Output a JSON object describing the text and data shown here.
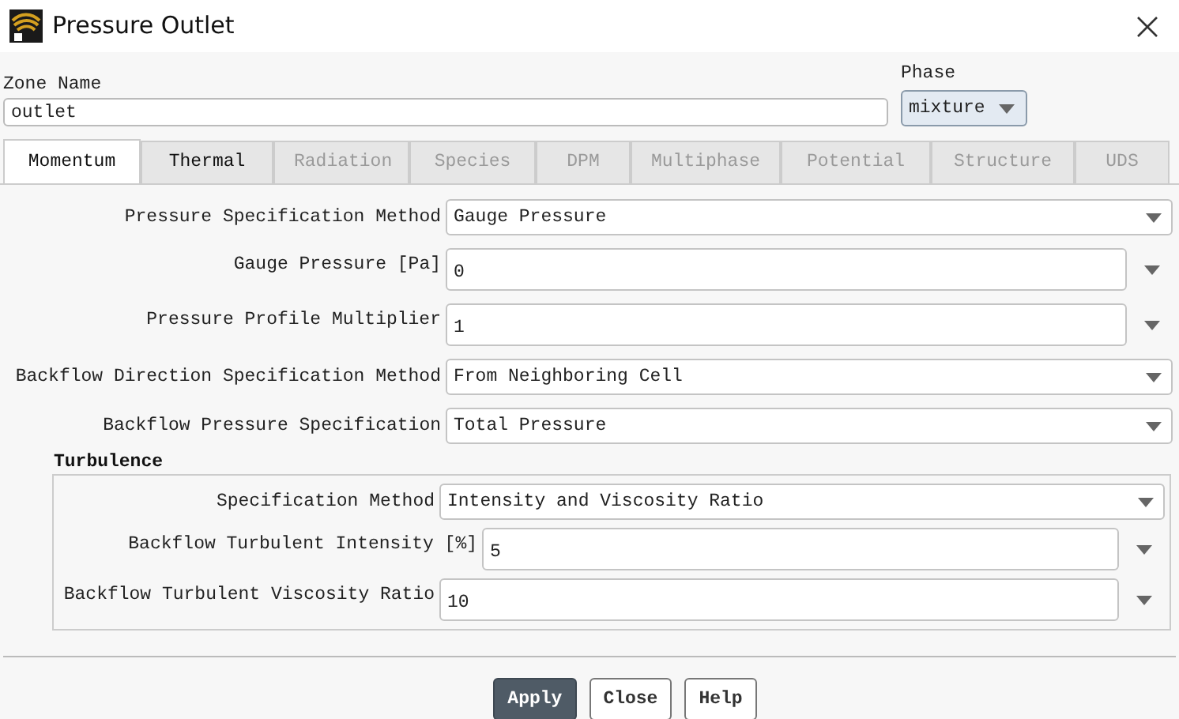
{
  "window": {
    "title": "Pressure Outlet"
  },
  "zone_name": {
    "label": "Zone Name",
    "value": "outlet"
  },
  "phase": {
    "label": "Phase",
    "value": "mixture"
  },
  "tabs": [
    {
      "label": "Momentum",
      "selected": true,
      "disabled": false
    },
    {
      "label": "Thermal",
      "selected": false,
      "disabled": false
    },
    {
      "label": "Radiation",
      "selected": false,
      "disabled": true
    },
    {
      "label": "Species",
      "selected": false,
      "disabled": true
    },
    {
      "label": "DPM",
      "selected": false,
      "disabled": true
    },
    {
      "label": "Multiphase",
      "selected": false,
      "disabled": true
    },
    {
      "label": "Potential",
      "selected": false,
      "disabled": true
    },
    {
      "label": "Structure",
      "selected": false,
      "disabled": true
    },
    {
      "label": "UDS",
      "selected": false,
      "disabled": true
    }
  ],
  "fields": [
    {
      "kind": "dropdown",
      "label": "Pressure Specification Method",
      "value": "Gauge Pressure"
    },
    {
      "kind": "input",
      "label": "Gauge Pressure [Pa]",
      "value": "0"
    },
    {
      "kind": "input",
      "label": "Pressure Profile Multiplier",
      "value": "1"
    },
    {
      "kind": "dropdown",
      "label": "Backflow Direction Specification Method",
      "value": "From Neighboring Cell"
    },
    {
      "kind": "dropdown",
      "label": "Backflow Pressure Specification",
      "value": "Total Pressure"
    }
  ],
  "turbulence": {
    "title": "Turbulence",
    "fields": [
      {
        "kind": "dropdown",
        "label": "Specification Method",
        "value": "Intensity and Viscosity Ratio"
      },
      {
        "kind": "input",
        "label": "Backflow Turbulent Intensity [%]",
        "value": "5"
      },
      {
        "kind": "input",
        "label": "Backflow Turbulent Viscosity Ratio",
        "value": "10"
      }
    ]
  },
  "buttons": [
    {
      "label": "Apply",
      "kind": "primary"
    },
    {
      "label": "Close",
      "kind": "normal"
    },
    {
      "label": "Help",
      "kind": "normal"
    }
  ]
}
